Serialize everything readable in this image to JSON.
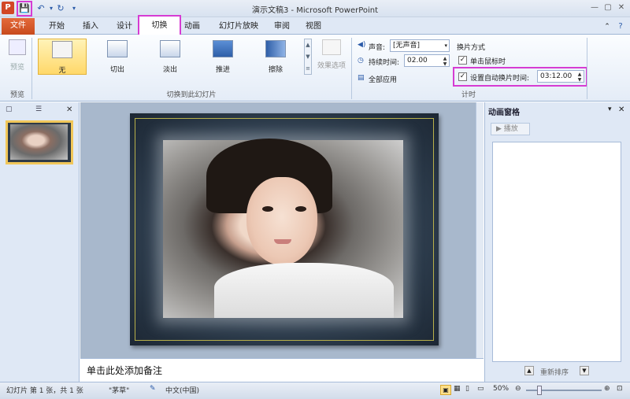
{
  "window": {
    "title": "演示文稿3 - Microsoft PowerPoint",
    "app_icon": "P",
    "controls": [
      "—",
      "▢",
      "✕"
    ]
  },
  "qat": {
    "save_icon": "💾",
    "undo_icon": "↶",
    "dropdown_icon": "▾",
    "redo_icon": "↻",
    "customize_icon": "▾"
  },
  "tabs": {
    "file": "文件",
    "items": [
      "开始",
      "插入",
      "设计",
      "切换",
      "动画",
      "幻灯片放映",
      "审阅",
      "视图"
    ],
    "active": "切换"
  },
  "ribbon": {
    "preview_group": {
      "button": "预览",
      "label": "预览"
    },
    "transitions_group": {
      "items": [
        "无",
        "切出",
        "淡出",
        "推进",
        "擦除"
      ],
      "selected": "无",
      "effect_options": "效果选项",
      "label": "切换到此幻灯片"
    },
    "timing": {
      "sound_label": "声音:",
      "sound_value": "[无声音]",
      "duration_label": "持续时间:",
      "duration_value": "02.00",
      "apply_all": "全部应用",
      "advance_heading": "换片方式",
      "on_click_label": "单击鼠标时",
      "on_click_checked": true,
      "auto_label": "设置自动换片时间:",
      "auto_checked": true,
      "auto_value": "03:12.00",
      "label": "计时"
    }
  },
  "left_panel": {
    "tab1_icon": "▢",
    "tab2_icon": "☰",
    "close_icon": "✕",
    "slide_number": "1"
  },
  "notes": {
    "placeholder": "单击此处添加备注"
  },
  "animation_pane": {
    "title": "动画窗格",
    "dropdown_icon": "▾",
    "close_icon": "✕",
    "play_label": "▶ 播放",
    "reorder_label": "重新排序"
  },
  "status": {
    "slide_info": "幻灯片 第 1 张，共 1 张",
    "theme": "\"茅草\"",
    "language": "中文(中国)",
    "zoom": "50%"
  },
  "colors": {
    "highlight": "#d63cd3",
    "file_tab": "#d24726",
    "selected_transition": "#ffd86a"
  }
}
